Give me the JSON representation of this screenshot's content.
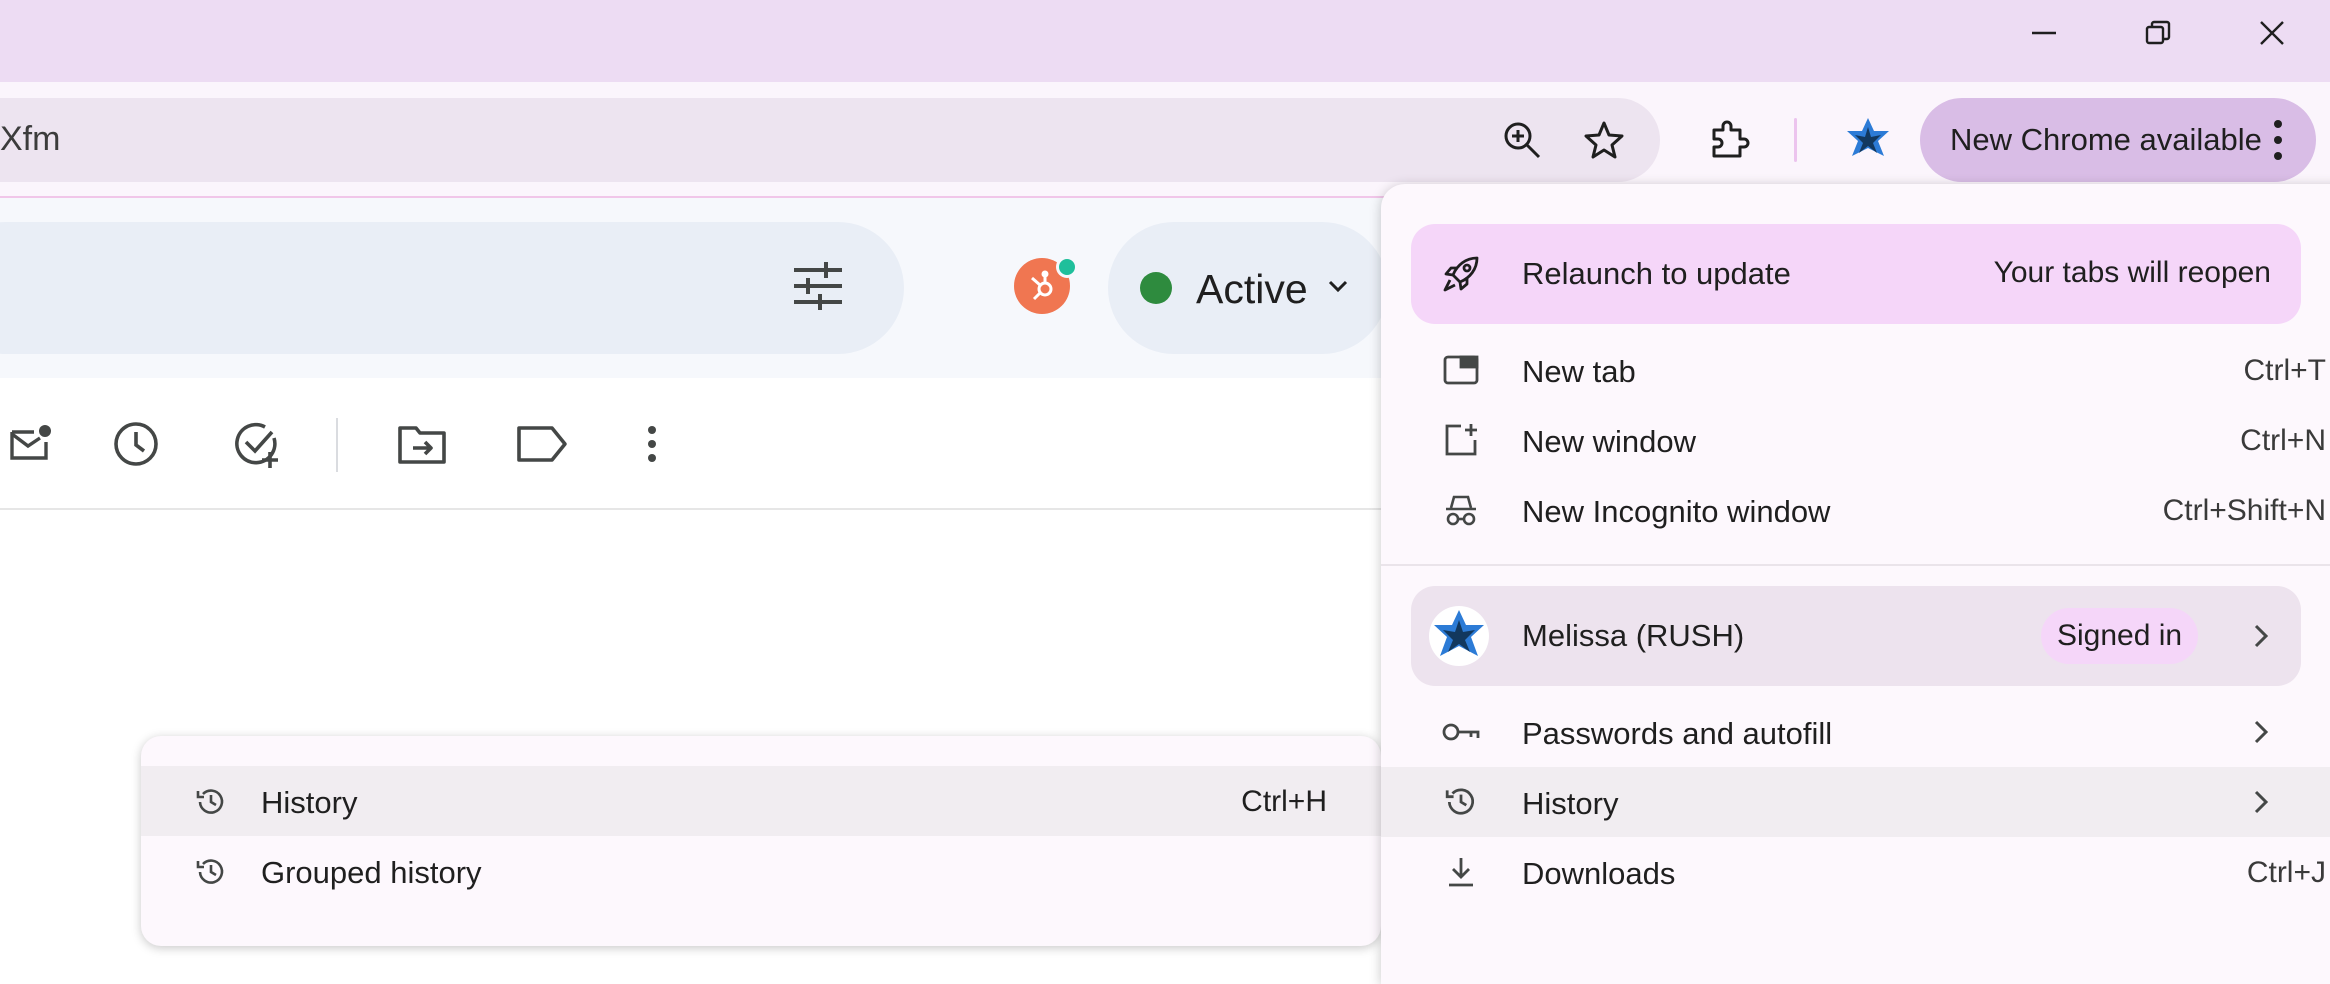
{
  "window": {
    "minimize_icon": "minimize-icon",
    "restore_icon": "restore-icon",
    "close_icon": "close-icon",
    "title_bar_color": "#eddcf3"
  },
  "toolbar": {
    "address_text": "Xfm",
    "zoom_icon": "zoom-in-icon",
    "bookmark_icon": "star-icon",
    "extensions_icon": "puzzle-icon",
    "profile_icon": "star-of-david-icon",
    "update_button_label": "New Chrome available",
    "more_icon": "vertical-dots-icon"
  },
  "gmail": {
    "search_options_icon": "tune-icon",
    "hubspot_icon": "hubspot-icon",
    "status_label": "Active",
    "status_color": "#2e8b3e",
    "actions": [
      "mark-unread-icon",
      "snooze-clock-icon",
      "add-task-icon",
      "move-to-folder-icon",
      "label-icon",
      "more-vert-icon"
    ]
  },
  "history_submenu": {
    "items": [
      {
        "label": "History",
        "shortcut": "Ctrl+H",
        "icon": "history-icon"
      },
      {
        "label": "Grouped history",
        "shortcut": "",
        "icon": "history-icon"
      }
    ]
  },
  "menu": {
    "relaunch": {
      "label": "Relaunch to update",
      "note": "Your tabs will reopen",
      "icon": "rocket-icon"
    },
    "items": [
      {
        "label": "New tab",
        "shortcut": "Ctrl+T",
        "icon": "new-tab-icon"
      },
      {
        "label": "New window",
        "shortcut": "Ctrl+N",
        "icon": "new-window-icon"
      },
      {
        "label": "New Incognito window",
        "shortcut": "Ctrl+Shift+N",
        "icon": "incognito-icon"
      }
    ],
    "profile": {
      "name": "Melissa (RUSH)",
      "status": "Signed in",
      "icon": "star-of-david-icon"
    },
    "items2": [
      {
        "label": "Passwords and autofill",
        "icon": "key-icon"
      },
      {
        "label": "History",
        "icon": "history-icon"
      },
      {
        "label": "Downloads",
        "shortcut": "Ctrl+J",
        "icon": "download-icon"
      }
    ],
    "accent_color": "#f5d6f9"
  }
}
